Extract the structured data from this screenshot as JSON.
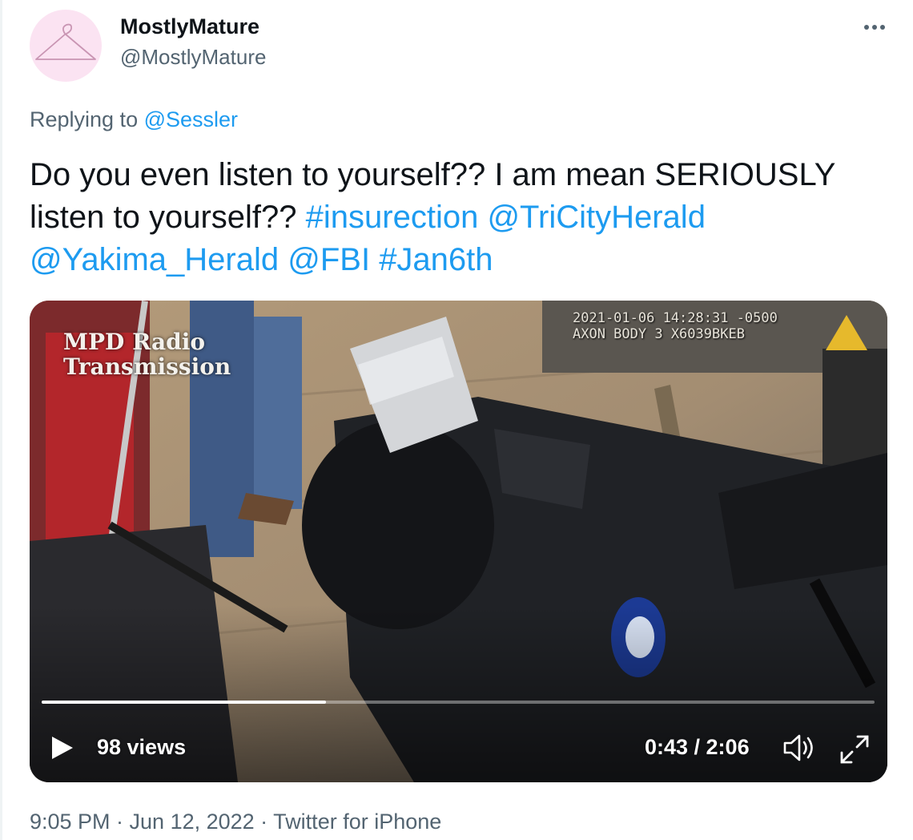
{
  "author": {
    "name": "MostlyMature",
    "handle": "@MostlyMature",
    "avatar_icon": "hanger-icon",
    "avatar_bg": "#fbe3f2"
  },
  "more_icon": "more-icon",
  "reply": {
    "prefix": "Replying to",
    "mention": "@Sessler"
  },
  "tweet": {
    "text_plain_1": "Do you even listen to yourself?? I am mean SERIOUSLY listen to yourself??",
    "hashtag_insurrection": "#insurection",
    "mention_tricity": "@TriCityHerald",
    "mention_yakima": "@Yakima_Herald",
    "mention_fbi": "@FBI",
    "hashtag_jan6": "#Jan6th"
  },
  "video": {
    "overlay_title_line1": "MPD Radio",
    "overlay_title_line2": "Transmission",
    "bodycam_line1": "2021-01-06 14:28:31 -0500",
    "bodycam_line2": "AXON BODY 3 X6039BKEB",
    "views": "98 views",
    "time": "0:43 / 2:06",
    "progress_fraction": 0.341,
    "icons": [
      "play-icon",
      "volume-icon",
      "fullscreen-icon"
    ]
  },
  "meta": {
    "timestamp": "9:05 PM · Jun 12, 2022 · Twitter for iPhone"
  },
  "colors": {
    "link": "#1d9bf0",
    "secondary_text": "#536471",
    "primary_text": "#0f1419"
  }
}
